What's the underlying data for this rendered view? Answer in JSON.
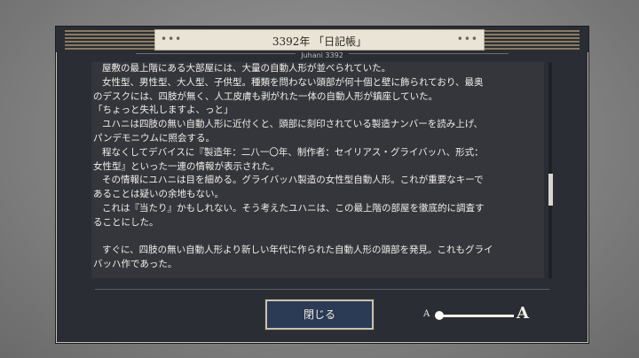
{
  "header": {
    "title": "3392年 「日記帳」",
    "subtitle": "Juhani 3392",
    "dots_left": "•••",
    "dots_right": "•••"
  },
  "content": {
    "lines": [
      "屋敷の最上階にある大部屋には、大量の自動人形が並べられていた。",
      "女性型、男性型、大人型、子供型。種類を問わない頭部が何十個と壁に飾られており、最奥",
      "のデスクには、四肢が無く、人工皮膚も剥がれた一体の自動人形が鎮座していた。",
      "「ちょっと失礼しますよ、っと」",
      "ユハニは四肢の無い自動人形に近付くと、頭部に刻印されている製造ナンバーを読み上げ、",
      "パンデモニウムに照会する。",
      "程なくしてデバイスに『製造年：二八一〇年、制作者：セイリアス・グライバッハ、形式：",
      "女性型』といった一連の情報が表示された。",
      "その情報にユハニは目を細める。グライバッハ製造の女性型自動人形。これが重要なキーで",
      "あることは疑いの余地もない。",
      "これは『当たり』かもしれない。そう考えたユハニは、この最上階の部屋を徹底的に調査す",
      "ることにした。",
      "",
      "すぐに、四肢の無い自動人形より新しい年代に作られた自動人形の頭部を発見。これもグライ",
      "バッハ作であった。"
    ]
  },
  "footer": {
    "close_label": "閉じる",
    "font_small_label": "A",
    "font_large_label": "A",
    "font_size_level": 0.0
  }
}
